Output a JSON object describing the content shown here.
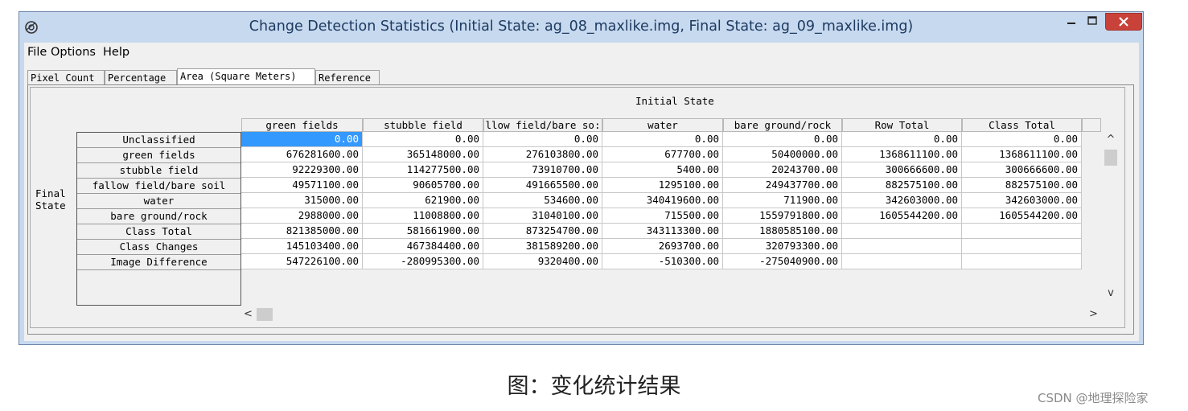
{
  "window": {
    "title": "Change Detection Statistics (Initial State: ag_08_maxlike.img, Final State: ag_09_maxlike.img)",
    "icons": {
      "app": "app-globe-icon",
      "minimize": "minimize-icon",
      "maximize": "maximize-icon",
      "close": "close-icon"
    },
    "close_color": "#c9423a"
  },
  "menu": [
    {
      "label": "File"
    },
    {
      "label": "Options"
    },
    {
      "label": "Help"
    }
  ],
  "tabs": [
    {
      "label": "Pixel Count",
      "active": false
    },
    {
      "label": "Percentage",
      "active": false
    },
    {
      "label": "Area (Square Meters)",
      "active": true
    },
    {
      "label": "Reference",
      "active": false
    }
  ],
  "table": {
    "initial_state_label": "Initial State",
    "final_state_label_line1": "Final",
    "final_state_label_line2": "State",
    "columns": [
      "green fields",
      "stubble field",
      "llow field/bare so:",
      "water",
      "bare ground/rock",
      "Row Total",
      "Class Total"
    ],
    "rows": [
      {
        "label": "Unclassified",
        "cells": [
          "0.00",
          "0.00",
          "0.00",
          "0.00",
          "0.00",
          "0.00",
          "0.00"
        ]
      },
      {
        "label": "green fields",
        "cells": [
          "676281600.00",
          "365148000.00",
          "276103800.00",
          "677700.00",
          "50400000.00",
          "1368611100.00",
          "1368611100.00"
        ]
      },
      {
        "label": "stubble field",
        "cells": [
          "92229300.00",
          "114277500.00",
          "73910700.00",
          "5400.00",
          "20243700.00",
          "300666600.00",
          "300666600.00"
        ]
      },
      {
        "label": "fallow field/bare soil",
        "cells": [
          "49571100.00",
          "90605700.00",
          "491665500.00",
          "1295100.00",
          "249437700.00",
          "882575100.00",
          "882575100.00"
        ]
      },
      {
        "label": "water",
        "cells": [
          "315000.00",
          "621900.00",
          "534600.00",
          "340419600.00",
          "711900.00",
          "342603000.00",
          "342603000.00"
        ]
      },
      {
        "label": "bare ground/rock",
        "cells": [
          "2988000.00",
          "11008800.00",
          "31040100.00",
          "715500.00",
          "1559791800.00",
          "1605544200.00",
          "1605544200.00"
        ]
      },
      {
        "label": "Class Total",
        "cells": [
          "821385000.00",
          "581661900.00",
          "873254700.00",
          "343113300.00",
          "1880585100.00",
          "",
          ""
        ]
      },
      {
        "label": "Class Changes",
        "cells": [
          "145103400.00",
          "467384400.00",
          "381589200.00",
          "2693700.00",
          "320793300.00",
          "",
          ""
        ]
      },
      {
        "label": "Image Difference",
        "cells": [
          "547226100.00",
          "-280995300.00",
          "9320400.00",
          "-510300.00",
          "-275040900.00",
          "",
          ""
        ]
      }
    ],
    "selected_cell": "0.00"
  },
  "scroll": {
    "up": "^",
    "down": "v",
    "left": "<",
    "right": ">"
  },
  "caption": "图：变化统计结果",
  "watermark": "CSDN @地理探险家"
}
